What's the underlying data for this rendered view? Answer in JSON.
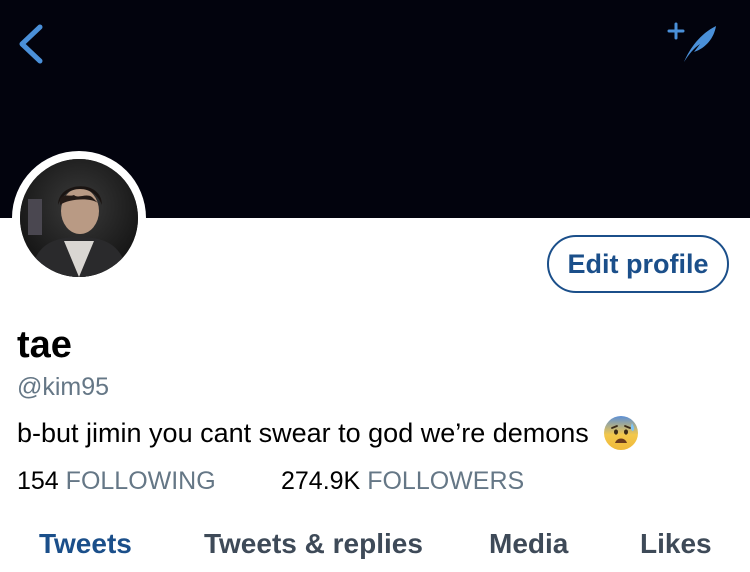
{
  "colors": {
    "header_bg": "#02030d",
    "accent": "#1b4f8a",
    "icon_blue": "#4a90d9",
    "muted_text": "#657786",
    "tab_text": "#3e4a58"
  },
  "header": {
    "back_icon": "chevron-left-icon",
    "compose_icon": "compose-tweet-icon"
  },
  "profile": {
    "name": "tae",
    "handle": "@kim95",
    "bio": "b-but jimin you cant swear to god we’re demons",
    "bio_emoji": "anxious-face-with-sweat-emoji",
    "edit_button_label": "Edit profile"
  },
  "stats": {
    "following_count": "154",
    "following_label": "FOLLOWING",
    "followers_count": "274.9K",
    "followers_label": "FOLLOWERS"
  },
  "tabs": [
    {
      "label": "Tweets",
      "active": true
    },
    {
      "label": "Tweets & replies",
      "active": false
    },
    {
      "label": "Media",
      "active": false
    },
    {
      "label": "Likes",
      "active": false
    }
  ]
}
